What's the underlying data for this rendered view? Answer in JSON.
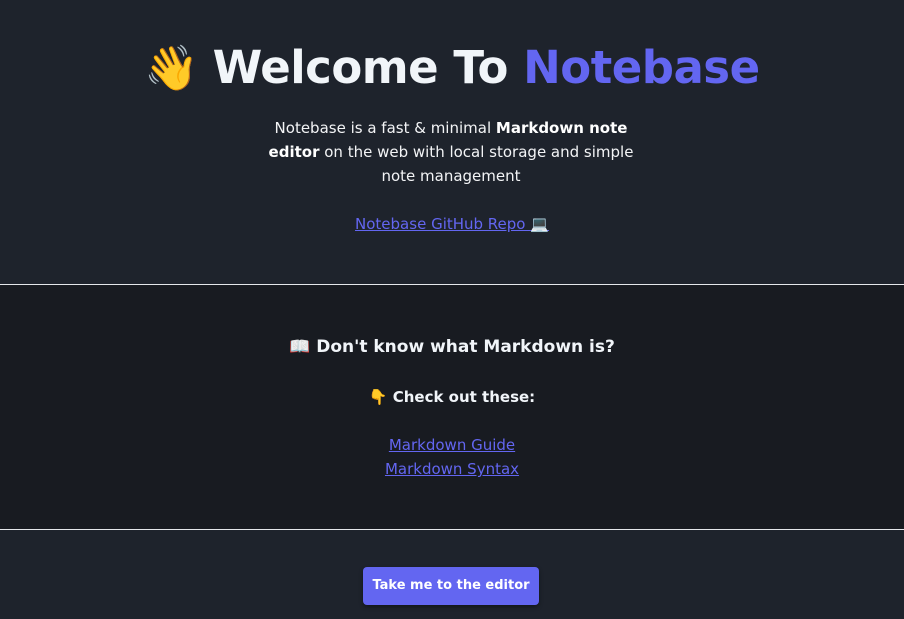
{
  "hero": {
    "wave_emoji": "👋",
    "title_prefix": "Welcome To ",
    "title_brand": "Notebase",
    "intro_part1": "Notebase is a fast & minimal ",
    "intro_bold": "Markdown note editor",
    "intro_part2": " on the web with local storage and simple note management",
    "repo_link_label": "Notebase GitHub Repo",
    "repo_link_emoji": "💻"
  },
  "learn": {
    "heading_emoji": "📖",
    "heading_text": "Don't know what Markdown is?",
    "check_emoji": "👇",
    "check_text": "Check out these:",
    "links": [
      {
        "label": "Markdown Guide"
      },
      {
        "label": "Markdown Syntax"
      }
    ]
  },
  "footer": {
    "editor_button_label": "Take me to the editor"
  },
  "colors": {
    "accent": "#6366f1",
    "hero_background": "#1e232c",
    "section_background": "#181b21",
    "divider": "#e5e7eb"
  }
}
